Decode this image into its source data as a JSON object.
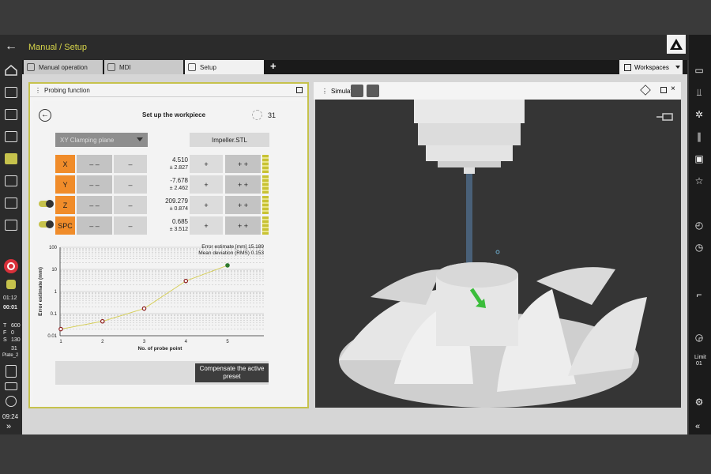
{
  "header": {
    "breadcrumb": "Manual / Setup"
  },
  "tabs": [
    {
      "label": "Manual operation",
      "icon": "hand-icon"
    },
    {
      "label": "MDI",
      "icon": "mdi-icon"
    },
    {
      "label": "Setup",
      "icon": "setup-icon"
    }
  ],
  "workspaces": {
    "label": "Workspaces"
  },
  "leftbar": {
    "time1": "01:12",
    "time2": "00:01",
    "t_label": "T",
    "t_val": "600",
    "f_label": "F",
    "f_val": "0",
    "s_label": "S",
    "s_val": "130",
    "preset_val": "31",
    "plate_label": "Plate_2",
    "clock": "09:24",
    "expand": "»"
  },
  "rightbar": {
    "limit_label": "Limit",
    "limit_val": "01",
    "collapse": "«"
  },
  "probe": {
    "panel_title": "Probing function",
    "title": "Set up the workpiece",
    "counter": "31",
    "dropdown": "XY Clamping plane",
    "file": "Impeller.STL",
    "rows": [
      {
        "axis": "X",
        "val": "4.510",
        "dev": "± 2.827",
        "mm": "– –",
        "m": "–",
        "p": "+",
        "pp": "+ +"
      },
      {
        "axis": "Y",
        "val": "-7.678",
        "dev": "± 2.462",
        "mm": "– –",
        "m": "–",
        "p": "+",
        "pp": "+ +"
      },
      {
        "axis": "Z",
        "val": "209.279",
        "dev": "± 0.874",
        "mm": "– –",
        "m": "–",
        "p": "+",
        "pp": "+ +"
      },
      {
        "axis": "SPC",
        "val": "0.685",
        "dev": "± 3.512",
        "mm": "– –",
        "m": "–",
        "p": "+",
        "pp": "+ +"
      }
    ],
    "compensate": "Compensate the active preset"
  },
  "chart_data": {
    "type": "line",
    "xlabel": "No. of probe point",
    "ylabel": "Error estimate (mm)",
    "x": [
      1,
      2,
      3,
      4,
      5
    ],
    "y": [
      0.02,
      0.045,
      0.17,
      3.0,
      15.189
    ],
    "yscale": "log",
    "ylim": [
      0.01,
      100
    ],
    "yticks": [
      "100",
      "10",
      "1",
      "0.1",
      "0.01"
    ],
    "xticks": [
      "1",
      "2",
      "3",
      "4",
      "5"
    ],
    "annotation1": "Error estimate [mm] 15.189",
    "annotation2": "Mean deviation (RMS) 0.153",
    "line_color": "#d6cf5a",
    "point_color": "#8b1d1d",
    "last_point_color": "#2f7a2f"
  },
  "simulation": {
    "title": "Simulation"
  },
  "colors": {
    "accent": "#c6c24c",
    "axis": "#f08c2a",
    "breadcrumb": "#d7d54a"
  }
}
